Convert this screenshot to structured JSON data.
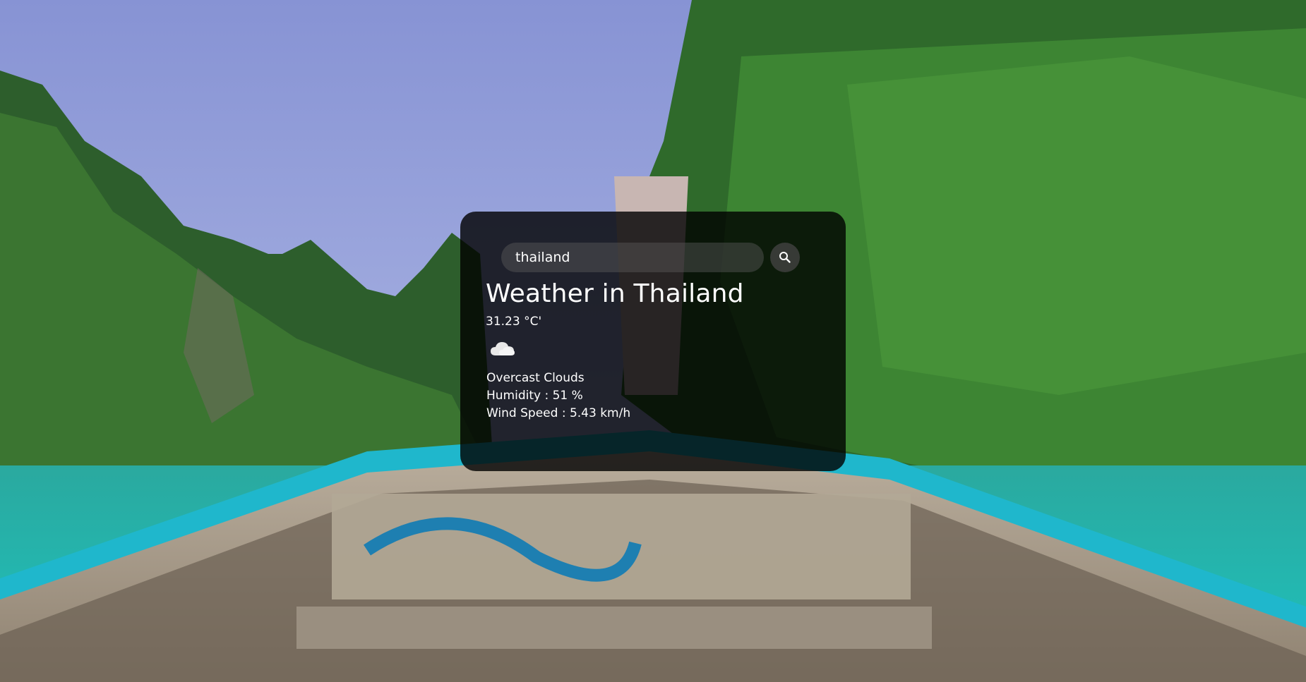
{
  "search": {
    "value": "thailand",
    "placeholder": "Search"
  },
  "weather": {
    "title": "Weather in Thailand",
    "temperature": "31.23 °C'",
    "icon": "cloud-icon",
    "description": "Overcast Clouds",
    "humidity": "Humidity : 51 %",
    "wind_speed": "Wind Speed : 5.43 km/h"
  },
  "colors": {
    "card_background": "#000000",
    "text": "#ffffff",
    "water": "#1fb3b0",
    "boat_trim": "#25b5c9"
  }
}
